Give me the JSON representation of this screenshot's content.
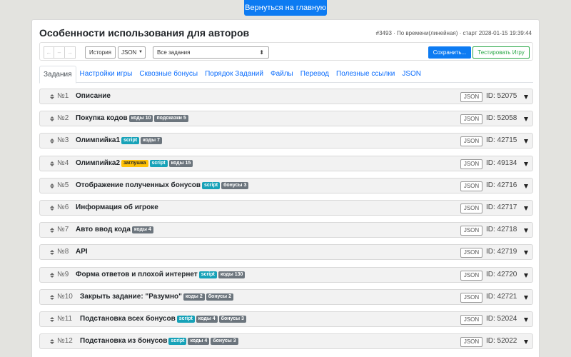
{
  "home_button": "Вернуться на главную",
  "page_title": "Особенности использования для авторов",
  "game_info": "#3493 · По времени(линейная) · старт 2028-01-15 19:39:44",
  "toolbar": {
    "history_label": "История",
    "json_label": "JSON",
    "select_value": "Все задания",
    "save_label": "Сохранить...",
    "test_label": "Тестировать Игру"
  },
  "tabs": [
    "Задания",
    "Настройки игры",
    "Сквозные бонусы",
    "Порядок Заданий",
    "Файлы",
    "Перевод",
    "Полезные ссылки",
    "JSON"
  ],
  "json_tag_label": "JSON",
  "tasks": [
    {
      "num": "№1",
      "name": "Описание",
      "badges": [],
      "id": "ID: 52075"
    },
    {
      "num": "№2",
      "name": "Покупка кодов",
      "badges": [
        {
          "text": "коды 10",
          "color": "gray"
        },
        {
          "text": "подсказки 5",
          "color": "gray"
        }
      ],
      "id": "ID: 52058"
    },
    {
      "num": "№3",
      "name": "Олимпийка1",
      "badges": [
        {
          "text": "script",
          "color": "cyan"
        },
        {
          "text": "коды 7",
          "color": "gray"
        }
      ],
      "id": "ID: 42715"
    },
    {
      "num": "№4",
      "name": "Олимпийка2",
      "badges": [
        {
          "text": "заглушка",
          "color": "yellow"
        },
        {
          "text": "script",
          "color": "cyan"
        },
        {
          "text": "коды 15",
          "color": "gray"
        }
      ],
      "id": "ID: 49134"
    },
    {
      "num": "№5",
      "name": "Отображение полученных бонусов",
      "badges": [
        {
          "text": "script",
          "color": "cyan"
        },
        {
          "text": "бонусы 3",
          "color": "gray"
        }
      ],
      "id": "ID: 42716"
    },
    {
      "num": "№6",
      "name": "Информация об игроке",
      "badges": [],
      "id": "ID: 42717"
    },
    {
      "num": "№7",
      "name": "Авто ввод кода",
      "badges": [
        {
          "text": "коды 4",
          "color": "gray"
        }
      ],
      "id": "ID: 42718"
    },
    {
      "num": "№8",
      "name": "API",
      "badges": [],
      "id": "ID: 42719"
    },
    {
      "num": "№9",
      "name": "Форма ответов и плохой интернет",
      "badges": [
        {
          "text": "script",
          "color": "cyan"
        },
        {
          "text": "коды 130",
          "color": "gray"
        }
      ],
      "id": "ID: 42720"
    },
    {
      "num": "№10",
      "name": "Закрыть задание: \"Разумно\"",
      "badges": [
        {
          "text": "коды 2",
          "color": "gray"
        },
        {
          "text": "бонусы 2",
          "color": "gray"
        }
      ],
      "id": "ID: 42721"
    },
    {
      "num": "№11",
      "name": "Подстановка всех бонусов",
      "badges": [
        {
          "text": "script",
          "color": "cyan"
        },
        {
          "text": "коды 4",
          "color": "gray"
        },
        {
          "text": "бонусы 3",
          "color": "gray"
        }
      ],
      "id": "ID: 52024"
    },
    {
      "num": "№12",
      "name": "Подстановка из бонусов",
      "badges": [
        {
          "text": "script",
          "color": "cyan"
        },
        {
          "text": "коды 4",
          "color": "gray"
        },
        {
          "text": "бонусы 3",
          "color": "gray"
        }
      ],
      "id": "ID: 52022"
    }
  ]
}
